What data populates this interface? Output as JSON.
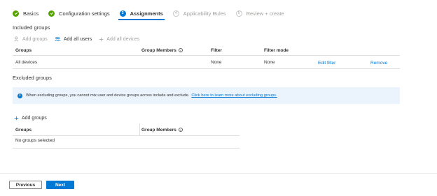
{
  "steps": [
    {
      "label": "Basics",
      "state": "done"
    },
    {
      "label": "Configuration settings",
      "state": "done"
    },
    {
      "label": "Assignments",
      "state": "current",
      "number": "3"
    },
    {
      "label": "Applicability Rules",
      "state": "todo",
      "number": "4"
    },
    {
      "label": "Review + create",
      "state": "todo",
      "number": "5"
    }
  ],
  "included": {
    "title": "Included groups",
    "toolbar": {
      "add_groups": "Add groups",
      "add_all_users": "Add all users",
      "add_all_devices": "Add all devices"
    },
    "columns": {
      "groups": "Groups",
      "group_members": "Group Members",
      "filter": "Filter",
      "filter_mode": "Filter mode"
    },
    "rows": [
      {
        "group": "All devices",
        "filter": "None",
        "filter_mode": "None",
        "edit": "Edit filter",
        "remove": "Remove"
      }
    ]
  },
  "excluded": {
    "title": "Excluded groups",
    "info": "When excluding groups, you cannot mix user and device groups across include and exclude.",
    "info_link": "Click here to learn more about excluding groups.",
    "add_groups": "Add groups",
    "columns": {
      "groups": "Groups",
      "group_members": "Group Members"
    },
    "empty": "No groups selected"
  },
  "footer": {
    "previous": "Previous",
    "next": "Next"
  },
  "colors": {
    "accent": "#0078d4",
    "success": "#57a300",
    "info_bg": "#ebf3fc"
  }
}
